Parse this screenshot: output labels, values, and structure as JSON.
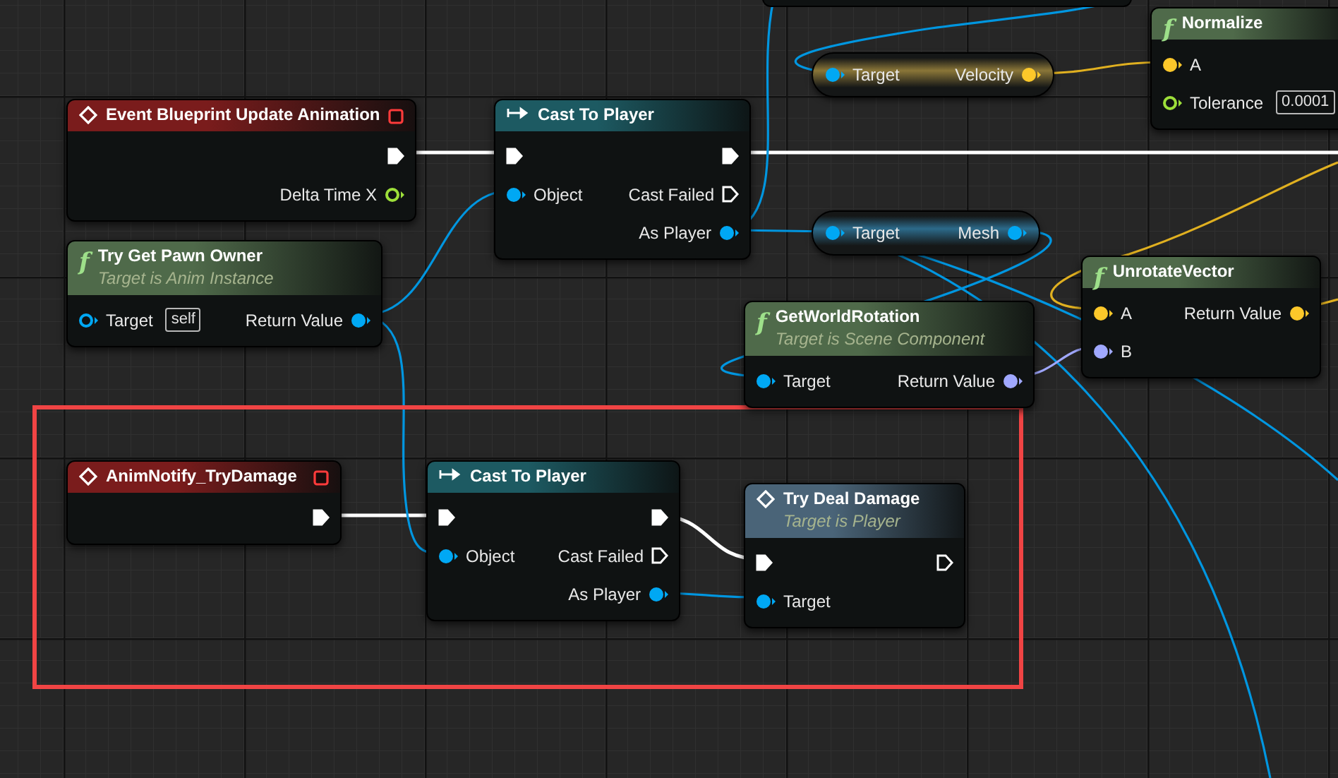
{
  "nodes": [
    {
      "kind": "event",
      "title": "Event Blueprint Update Animation",
      "color": "#7a1c1c",
      "rows": [
        {
          "right": {
            "kind": "exec",
            "connected": true
          }
        },
        {
          "right": {
            "kind": "data",
            "label": "Delta Time X",
            "color": "#9ddf3a",
            "connected": false
          }
        }
      ]
    },
    {
      "kind": "cast",
      "title": "Cast To Player",
      "color": "#1d5a62",
      "rows": [
        {
          "left": {
            "kind": "exec",
            "connected": true
          },
          "right": {
            "kind": "exec",
            "connected": true
          }
        },
        {
          "left": {
            "kind": "data",
            "label": "Object",
            "color": "#00a8f4",
            "connected": true
          },
          "right": {
            "kind": "exec",
            "label": "Cast Failed",
            "connected": false
          }
        },
        {
          "right": {
            "kind": "data",
            "label": "As Player",
            "color": "#00a8f4",
            "connected": true
          }
        }
      ]
    },
    {
      "kind": "function",
      "icon": "f",
      "title": "Try Get Pawn Owner",
      "subtitle": "Target is Anim Instance",
      "color": "#4f6a4a",
      "rows": [
        {
          "left": {
            "kind": "data",
            "label": "Target",
            "default": "self",
            "color": "#00a8f4",
            "connected": false
          },
          "right": {
            "kind": "data",
            "label": "Return Value",
            "color": "#00a8f4",
            "connected": true
          }
        }
      ]
    },
    {
      "kind": "getter",
      "color": "#8a7638",
      "rows": [
        {
          "left": {
            "kind": "data",
            "label": "Target",
            "color": "#00a8f4",
            "connected": true
          },
          "right": {
            "kind": "data",
            "label": "Velocity",
            "color": "#fdc82a",
            "connected": true
          }
        }
      ]
    },
    {
      "kind": "function",
      "icon": "f",
      "title": "Normalize",
      "color": "#4f6a4a",
      "rows": [
        {
          "left": {
            "kind": "data",
            "label": "A",
            "color": "#fdc82a",
            "connected": true
          }
        },
        {
          "left": {
            "kind": "data",
            "label": "Tolerance",
            "default": "0.0001",
            "color": "#9ddf3a",
            "connected": false
          }
        }
      ]
    },
    {
      "kind": "getter",
      "color": "#2c6a8a",
      "rows": [
        {
          "left": {
            "kind": "data",
            "label": "Target",
            "color": "#00a8f4",
            "connected": true
          },
          "right": {
            "kind": "data",
            "label": "Mesh",
            "color": "#00a8f4",
            "connected": true
          }
        }
      ]
    },
    {
      "kind": "function",
      "icon": "f",
      "title": "UnrotateVector",
      "color": "#4f6a4a",
      "rows": [
        {
          "left": {
            "kind": "data",
            "label": "A",
            "color": "#fdc82a",
            "connected": true
          },
          "right": {
            "kind": "data",
            "label": "Return Value",
            "color": "#fdc82a",
            "connected": true
          }
        },
        {
          "left": {
            "kind": "data",
            "label": "B",
            "color": "#a0a8ff",
            "connected": true
          }
        }
      ]
    },
    {
      "kind": "function",
      "icon": "f",
      "title": "GetWorldRotation",
      "subtitle": "Target is Scene Component",
      "color": "#4f6a4a",
      "rows": [
        {
          "left": {
            "kind": "data",
            "label": "Target",
            "color": "#00a8f4",
            "connected": true
          },
          "right": {
            "kind": "data",
            "label": "Return Value",
            "color": "#a0a8ff",
            "connected": true
          }
        }
      ]
    },
    {
      "kind": "event",
      "title": "AnimNotify_TryDamage",
      "color": "#7a1c1c",
      "rows": [
        {
          "right": {
            "kind": "exec",
            "connected": true
          }
        }
      ]
    },
    {
      "kind": "cast",
      "title": "Cast To Player",
      "color": "#1d5a62",
      "rows": [
        {
          "left": {
            "kind": "exec",
            "connected": true
          },
          "right": {
            "kind": "exec",
            "connected": true
          }
        },
        {
          "left": {
            "kind": "data",
            "label": "Object",
            "color": "#00a8f4",
            "connected": true
          },
          "right": {
            "kind": "exec",
            "label": "Cast Failed",
            "connected": false
          }
        },
        {
          "right": {
            "kind": "data",
            "label": "As Player",
            "color": "#00a8f4",
            "connected": true
          }
        }
      ]
    },
    {
      "kind": "call",
      "title": "Try Deal Damage",
      "subtitle": "Target is Player",
      "color": "#4a6478",
      "rows": [
        {
          "left": {
            "kind": "exec",
            "connected": true
          },
          "right": {
            "kind": "exec",
            "connected": false
          }
        },
        {
          "left": {
            "kind": "data",
            "label": "Target",
            "color": "#00a8f4",
            "connected": true
          }
        }
      ]
    }
  ]
}
